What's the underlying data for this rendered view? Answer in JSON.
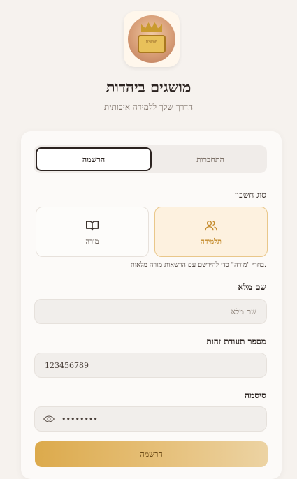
{
  "header": {
    "logo_text": "מושגים",
    "title": "מושגים ביהדות",
    "subtitle": "הדרך שלך ללמידה איכותית"
  },
  "tabs": [
    {
      "label": "התחברות",
      "active": false
    },
    {
      "label": "הרשמה",
      "active": true
    }
  ],
  "account_type": {
    "label": "סוג חשבון",
    "options": [
      {
        "label": "תלמידה",
        "icon": "users-icon",
        "selected": true
      },
      {
        "label": "מורה",
        "icon": "book-icon",
        "selected": false
      }
    ],
    "hint": "בחרי \"מורה\" כדי להירשם עם הרשאות מורה מלאות."
  },
  "fields": {
    "full_name": {
      "label": "שם מלא",
      "placeholder": "שם מלא",
      "value": ""
    },
    "id_number": {
      "label": "מספר תעודת זהות",
      "value": "123456789"
    },
    "password": {
      "label": "סיסמה",
      "value": "••••••••",
      "icon": "eye-icon"
    }
  },
  "submit": {
    "label": "הרשמה"
  },
  "colors": {
    "accent": "#dcaa4c",
    "accent_light": "#fdf1df",
    "background": "#f6f2ee",
    "text": "#2b2320"
  }
}
